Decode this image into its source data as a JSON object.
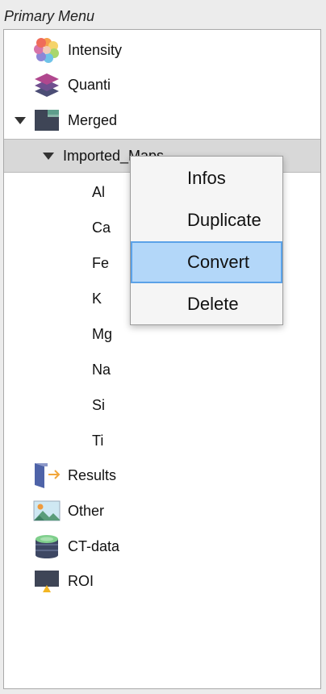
{
  "panel": {
    "title": "Primary Menu"
  },
  "tree": {
    "intensity": "Intensity",
    "quanti": "Quanti",
    "merged": "Merged",
    "imported_maps": "Imported_Maps",
    "elements": [
      "Al",
      "Ca",
      "Fe",
      "K",
      "Mg",
      "Na",
      "Si",
      "Ti"
    ],
    "results": "Results",
    "other": "Other",
    "ct_data": "CT-data",
    "roi": "ROI"
  },
  "context_menu": {
    "items": [
      "Infos",
      "Duplicate",
      "Convert",
      "Delete"
    ],
    "highlighted": "Convert"
  },
  "colors": {
    "selection_row": "#d8d8d8",
    "menu_highlight": "#b3d7f9",
    "menu_highlight_border": "#5ba2e8"
  }
}
